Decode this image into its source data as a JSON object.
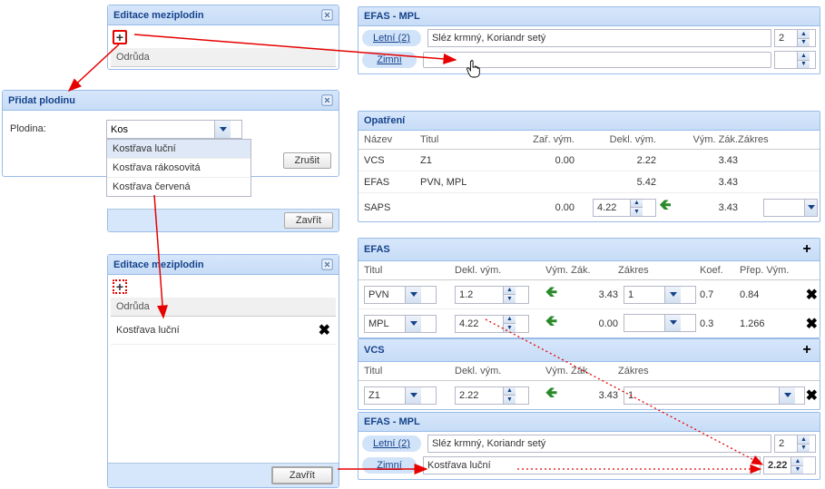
{
  "panel_edit1": {
    "title": "Editace meziplodin",
    "col_header": "Odrůda",
    "close_btn": "Zavřít"
  },
  "panel_add": {
    "title": "Přidat plodinu",
    "field_label": "Plodina:",
    "input_value": "Kos",
    "options": [
      "Kostřava luční",
      "Kostřava rákosovitá",
      "Kostřava červená"
    ],
    "cancel": "Zrušit"
  },
  "panel_edit2": {
    "title": "Editace meziplodin",
    "col_header": "Odrůda",
    "row_value": "Kostřava luční",
    "close_btn": "Zavřít"
  },
  "efas_mpl_top": {
    "title": "EFAS - MPL",
    "tabs": [
      "Letní (2)",
      "Zimní"
    ],
    "letni_value": "Sléz krmný, Koriandr setý",
    "letni_count": "2",
    "zimni_value": ""
  },
  "opatreni": {
    "title": "Opatření",
    "headers": [
      "Název",
      "Titul",
      "Zař. vým.",
      "Dekl. vým.",
      "Vým. Zák.",
      "Zákres"
    ],
    "rows": [
      {
        "nazev": "VCS",
        "titul": "Z1",
        "zar": "0.00",
        "dekl": "2.22",
        "vymzak": "3.43",
        "zakres": ""
      },
      {
        "nazev": "EFAS",
        "titul": "PVN, MPL",
        "zar": "",
        "dekl": "5.42",
        "vymzak": "3.43",
        "zakres": ""
      },
      {
        "nazev": "SAPS",
        "titul": "",
        "zar": "0.00",
        "dekl_spinner": "4.22",
        "vymzak": "3.43",
        "zakres_select": ""
      }
    ]
  },
  "efas": {
    "title": "EFAS",
    "headers": [
      "Titul",
      "Dekl. vým.",
      "Vým. Zák.",
      "Zákres",
      "Koef.",
      "Přep. Vým."
    ],
    "rows": [
      {
        "titul": "PVN",
        "dekl": "1.2",
        "vymzak": "3.43",
        "zakres": "1",
        "koef": "0.7",
        "prep": "0.84"
      },
      {
        "titul": "MPL",
        "dekl": "4.22",
        "vymzak": "0.00",
        "zakres": "",
        "koef": "0.3",
        "prep": "1.266"
      }
    ]
  },
  "vcs": {
    "title": "VCS",
    "headers": [
      "Titul",
      "Dekl. vým.",
      "Vým. Zák.",
      "Zákres"
    ],
    "rows": [
      {
        "titul": "Z1",
        "dekl": "2.22",
        "vymzak": "3.43",
        "zakres": "1"
      }
    ]
  },
  "efas_mpl_bottom": {
    "title": "EFAS - MPL",
    "tabs": [
      "Letní (2)",
      "Zimní"
    ],
    "letni_value": "Sléz krmný, Koriandr setý",
    "letni_count": "2",
    "zimni_value": "Kostřava luční",
    "zimni_count": "2.22"
  }
}
